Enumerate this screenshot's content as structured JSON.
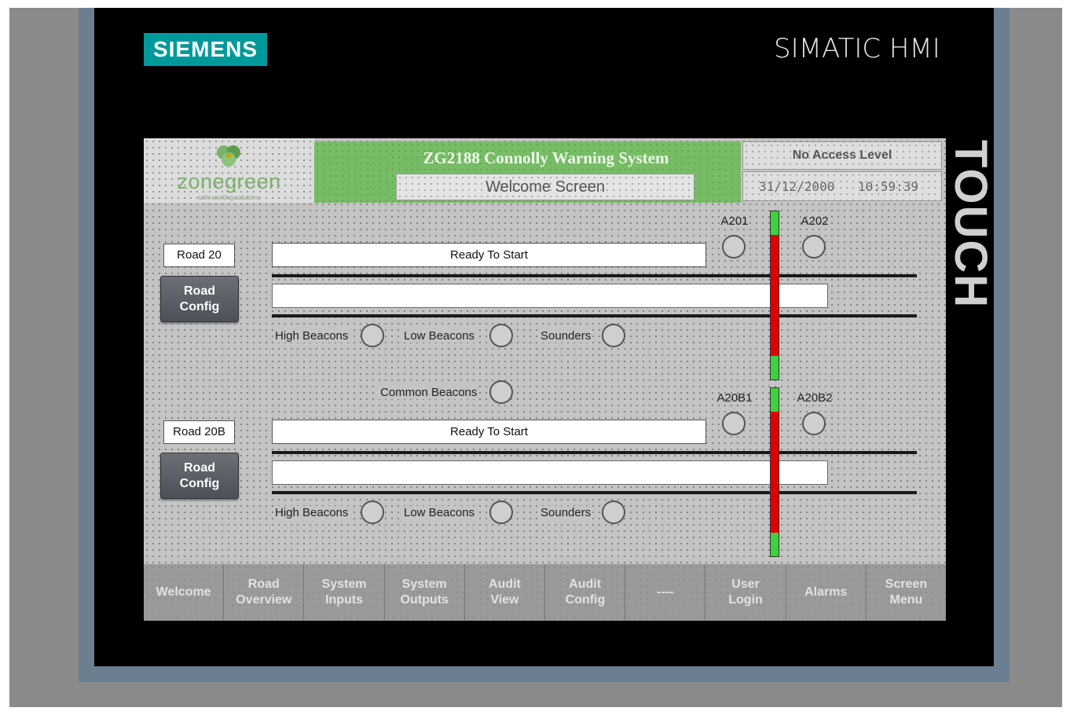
{
  "bezel": {
    "brand": "SIEMENS",
    "product": "SIMATIC HMI",
    "touch_label": "TOUCH"
  },
  "header": {
    "logo_name": "zonegreen",
    "logo_tagline": "safe working solutions",
    "title": "ZG2188 Connolly Warning System",
    "screen_name": "Welcome Screen",
    "access_level": "No Access Level",
    "date": "31/12/2000",
    "time": "10:59:39"
  },
  "roads": [
    {
      "label": "Road 20",
      "config_button": "Road Config",
      "status": "Ready To Start",
      "signals": [
        "A201",
        "A202"
      ],
      "indicators": [
        "High Beacons",
        "Low Beacons",
        "Sounders"
      ]
    },
    {
      "label": "Road 20B",
      "config_button": "Road Config",
      "status": "Ready To Start",
      "signals": [
        "A20B1",
        "A20B2"
      ],
      "indicators": [
        "High Beacons",
        "Low Beacons",
        "Sounders"
      ]
    }
  ],
  "common_beacons": "Common Beacons",
  "nav": [
    "Welcome",
    "Road Overview",
    "System Inputs",
    "System Outputs",
    "Audit View",
    "Audit Config",
    "----",
    "User Login",
    "Alarms",
    "Screen Menu"
  ],
  "colors": {
    "siemens_teal": "#009999",
    "title_green": "#77bd66",
    "bar_red": "#e00000",
    "bar_green": "#3cd23c"
  }
}
